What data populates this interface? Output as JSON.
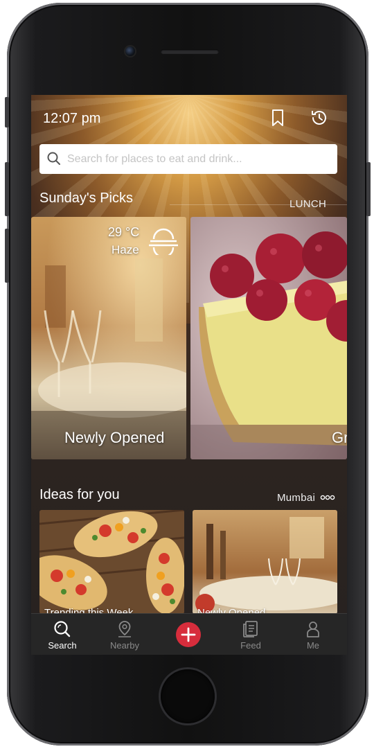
{
  "status": {
    "time": "12:07 pm"
  },
  "search": {
    "placeholder": "Search for places to eat and drink..."
  },
  "picks": {
    "title": "Sunday's Picks",
    "meal": "LUNCH",
    "weather": {
      "temp": "29 °C",
      "condition": "Haze"
    },
    "cards": [
      {
        "label": "Newly Opened"
      },
      {
        "label": "Gr"
      }
    ]
  },
  "ideas": {
    "title": "Ideas for you",
    "city": "Mumbai",
    "cards": [
      {
        "label": "Trending this Week"
      },
      {
        "label": "Newly Opened"
      }
    ]
  },
  "tabbar": {
    "items": [
      {
        "label": "Search",
        "icon": "search-icon",
        "active": true
      },
      {
        "label": "Nearby",
        "icon": "location-pin-icon",
        "active": false
      },
      {
        "label": "",
        "icon": "plus-icon",
        "active": false
      },
      {
        "label": "Feed",
        "icon": "feed-icon",
        "active": false
      },
      {
        "label": "Me",
        "icon": "user-icon",
        "active": false
      }
    ]
  },
  "colors": {
    "accent": "#d72d3c",
    "tab_inactive": "#8a8a8a"
  }
}
